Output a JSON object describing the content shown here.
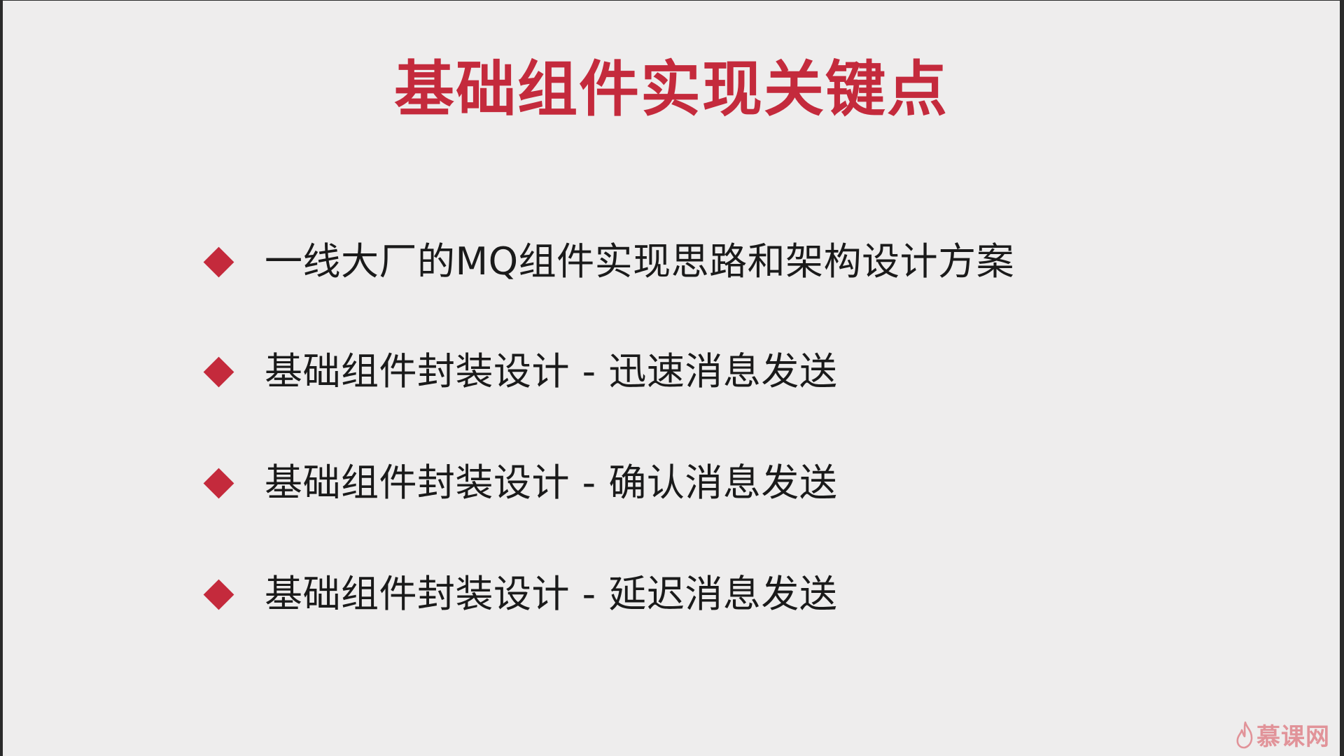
{
  "slide": {
    "title": "基础组件实现关键点",
    "bullets": [
      "一线大厂的MQ组件实现思路和架构设计方案",
      "基础组件封装设计 - 迅速消息发送",
      "基础组件封装设计 - 确认消息发送",
      "基础组件封装设计 - 延迟消息发送"
    ]
  },
  "watermark": {
    "text": "慕课网",
    "icon": "flame-logo-icon"
  },
  "colors": {
    "accent": "#c42a3c",
    "background": "#eeeded",
    "text": "#1a1a1a"
  }
}
